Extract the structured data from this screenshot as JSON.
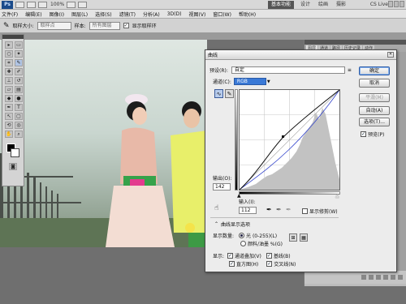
{
  "app": {
    "logo": "Ps",
    "zoom": "100%",
    "workspaces": [
      "基本功能",
      "设计",
      "绘画",
      "摄影"
    ],
    "cs_live": "CS Live"
  },
  "menu": [
    "文件(F)",
    "编辑(E)",
    "图像(I)",
    "图层(L)",
    "选择(S)",
    "滤镜(T)",
    "分析(A)",
    "3D(D)",
    "视图(V)",
    "窗口(W)",
    "帮助(H)"
  ],
  "options": {
    "sample_size_label": "取样大小:",
    "sample_size_value": "取样点",
    "sample_label": "样本:",
    "sample_value": "所有图层",
    "show_ring_label": "显示取样环"
  },
  "right_panel": {
    "tabs": [
      "图层",
      "通道",
      "路径",
      "历史记录",
      "动作"
    ]
  },
  "dialog": {
    "title": "曲线",
    "preset_label": "预设(R):",
    "preset_value": "自定",
    "channel_label": "通道(C):",
    "channel_value": "RGB",
    "output_label": "输出(O):",
    "output_value": "142",
    "input_label": "输入(I):",
    "input_value": "112",
    "show_clipping_label": "显示修剪(W)",
    "curve_options_label": "曲线显示选项",
    "amount_label": "显示数量:",
    "amount_light": "光 (0-255)(L)",
    "amount_pigment": "颜料/油墨 %(G)",
    "show_label": "显示:",
    "show_channel_overlays": "通道叠加(V)",
    "show_baseline": "基线(B)",
    "show_histogram": "直方图(H)",
    "show_intersection": "交叉线(N)",
    "buttons": {
      "ok": "确定",
      "cancel": "取消",
      "smooth": "平滑(M)",
      "auto": "自动(A)",
      "options": "选项(T)...",
      "preview": "预览(P)"
    }
  },
  "colors": {
    "accent": "#3a79d6",
    "histogram": "#bdbdbd",
    "curve": "#111111",
    "channel_curve": "#3344cc"
  }
}
